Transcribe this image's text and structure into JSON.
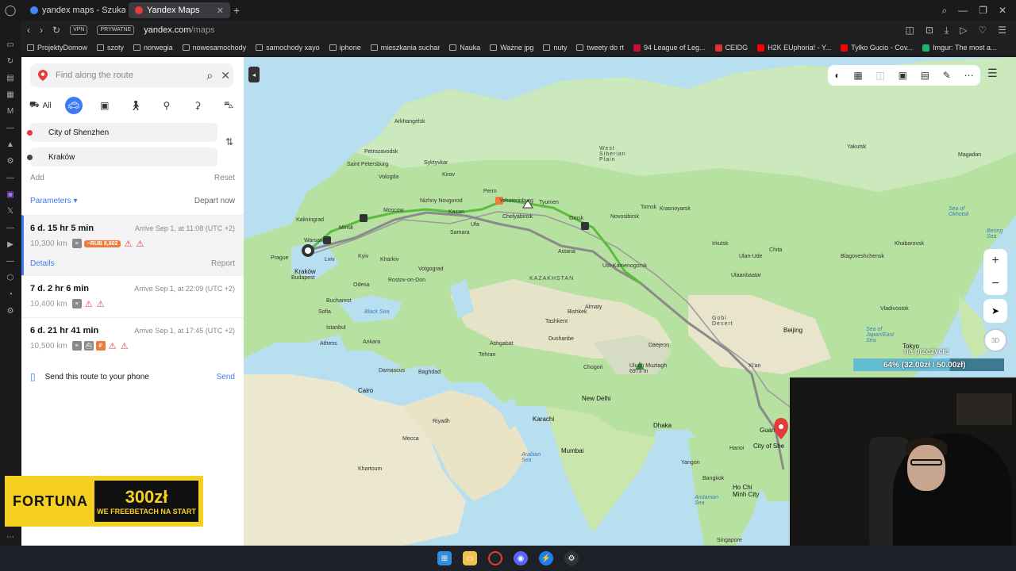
{
  "browser": {
    "tabs": [
      {
        "label": "yandex maps - Szukaj w G",
        "active": false
      },
      {
        "label": "Yandex Maps",
        "active": true
      }
    ],
    "vpn": "VPN",
    "private": "PRYWATNE",
    "url_host": "yandex.com",
    "url_path": "/maps",
    "bookmarks": [
      "ProjektyDomow",
      "szoty",
      "norwegia",
      "nowesamochody",
      "samochody xayo",
      "iphone",
      "mieszkania suchar",
      "Nauka",
      "Ważne jpg",
      "nuty",
      "tweety do rt",
      "94 League of Leg...",
      "CEIDG",
      "H2K EUphoria! - Y...",
      "Tylko Gucio - Cov...",
      "Imgur: The most a..."
    ]
  },
  "panel": {
    "search_placeholder": "Find along the route",
    "mode_all": "All",
    "from": "City of Shenzhen",
    "to": "Kraków",
    "add": "Add",
    "reset": "Reset",
    "parameters": "Parameters ▾",
    "depart": "Depart now",
    "routes": [
      {
        "duration": "6 d. 15 hr 5 min",
        "arrive": "Arrive Sep 1, at 11:08 (UTC +2)",
        "distance": "10,300 km",
        "toll": "~RUB 8,602",
        "details": "Details",
        "report": "Report"
      },
      {
        "duration": "7 d. 2 hr 6 min",
        "arrive": "Arrive Sep 1, at 22:09 (UTC +2)",
        "distance": "10,400 km"
      },
      {
        "duration": "6 d. 21 hr 41 min",
        "arrive": "Arrive Sep 1, at 17:45 (UTC +2)",
        "distance": "10,500 km"
      }
    ],
    "send_text": "Send this route to your phone",
    "send_button": "Send"
  },
  "ad": {
    "brand": "FORTUNA",
    "amount": "300zł",
    "tagline": "WE FREEBETACH NA START"
  },
  "map": {
    "labels": {
      "arkhangelsk": "Arkhangelsk",
      "petrozavodsk": "Petrozavodsk",
      "stpetersburg": "Saint\nPetersburg",
      "kaliningrad": "Kaliningrad",
      "warsaw": "Warsaw",
      "krakow": "Kraków",
      "prague": "Prague",
      "lviv": "Lviv",
      "budapest": "Budapest",
      "minsk": "Minsk",
      "kyiv": "Kyiv",
      "kharkiv": "Kharkiv",
      "moscow": "Moscow",
      "nizhny": "Nizhny Novgorod",
      "kazan": "Kazan",
      "perm": "Perm",
      "ekaterinburg": "Yekaterinburg",
      "chelyabinsk": "Chelyabinsk",
      "tyumen": "Tyumen",
      "omsk": "Omsk",
      "novosibirsk": "Novosibirsk",
      "krasnoyarsk": "Krasnoyarsk",
      "samara": "Samara",
      "volgograd": "Volgograd",
      "rostov": "Rostov-on-Don",
      "odesa": "Odesa",
      "bucharest": "Bucharest",
      "sofia": "Sofia",
      "istanbul": "Istanbul",
      "athens": "Athens",
      "ankara": "Ankara",
      "ufa": "Ufa",
      "astana": "Astana",
      "almaty": "Almaty",
      "tashkent": "Tashkent",
      "bishkek": "Bishkek",
      "ashgabat": "Ashgabat",
      "dushanbe": "Dushanbe",
      "tehran": "Tehran",
      "baghdad": "Baghdad",
      "damascus": "Damascus",
      "cairo": "Cairo",
      "riyadh": "Riyadh",
      "mecca": "Mecca",
      "khartoum": "Khartoum",
      "karachi": "Karachi",
      "newdelhi": "New Delhi",
      "mumbai": "Mumbai",
      "dhaka": "Dhaka",
      "yangon": "Yangon",
      "bangkok": "Bangkok",
      "hochiminh": "Ho Chi\nMinh City",
      "singapore": "Singapore",
      "beijing": "Beijing",
      "xian": "Xi'an",
      "guangzhou": "Guan",
      "shenzhen": "City of She",
      "tokyo": "Tokyo",
      "vladivostok": "Vladivostok",
      "blagoveshchensk": "Blagoveshchensk",
      "ulaanbaatar": "Ulaanbaatar",
      "irkutsk": "Irkutsk",
      "ulanude": "Ulan-Ude",
      "chita": "Chita",
      "yakutsk": "Yakutsk",
      "khabarovsk": "Khabarovsk",
      "magadan": "Magadan",
      "ust": "Ust-Kamenogorsk",
      "siberia_w": "West\nSiberian\nPlain",
      "kazakhstan": "KAZAKHSTAN",
      "gobi": "Gobi\nDesert",
      "chogori": "Chogori",
      "muztagh": "Ulugh Muztagh\n6973 m",
      "syktyvkar": "Syktyvkar",
      "vologda": "Vologda",
      "kirov": "Kirov",
      "tomsk": "Tomsk",
      "hanoi": "Hanoi",
      "daejeon": "Daejeon"
    },
    "seas": {
      "black": "Black Sea",
      "arabian": "Arabian\nSea",
      "andaman": "Andaman\nSea",
      "okhotsk": "Sea of\nOkhotsk",
      "japan": "Sea of\nJapan/East\nSea",
      "bering": "Bering\nSea"
    },
    "overlay_label": "na przeżycie",
    "overlay_value": "64% (32.00zł / 50.00zł)",
    "overlay_progress": 0.64,
    "button_3d": "3D"
  }
}
